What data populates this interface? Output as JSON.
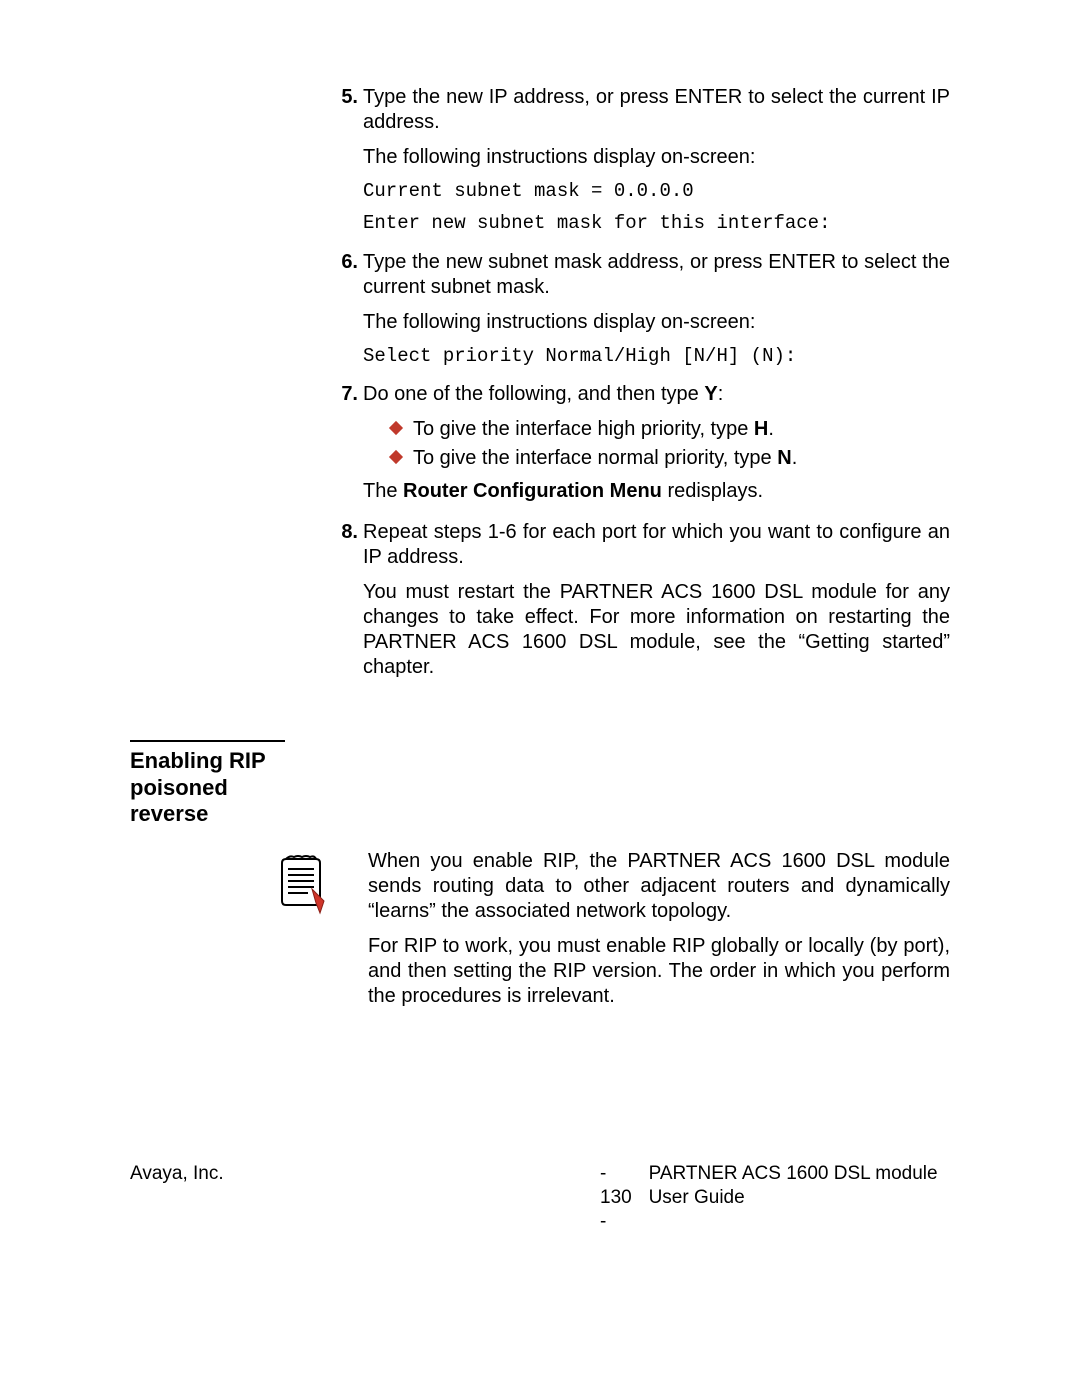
{
  "steps": {
    "s5": {
      "num": "5.",
      "p1": "Type the new IP address, or press ENTER to select the current IP address.",
      "p2": "The following instructions display on-screen:",
      "code1": "Current subnet mask = 0.0.0.0",
      "code2": "Enter new subnet mask for this interface:"
    },
    "s6": {
      "num": "6.",
      "p1": "Type the new subnet mask address, or press ENTER to select the current subnet mask.",
      "p2": "The following instructions display on-screen:",
      "code1": "Select priority Normal/High [N/H] (N):"
    },
    "s7": {
      "num": "7.",
      "p1_pre": "Do one of the following, and then type ",
      "p1_b": "Y",
      "p1_post": ":",
      "b1_pre": "To give the interface high priority, type ",
      "b1_b": "H",
      "b1_post": ".",
      "b2_pre": "To give the interface normal priority, type ",
      "b2_b": "N",
      "b2_post": ".",
      "p2_pre": "The ",
      "p2_b": "Router Configuration Menu",
      "p2_post": " redisplays."
    },
    "s8": {
      "num": "8.",
      "p1": "Repeat steps 1-6 for each port for which you want to configure an IP address.",
      "p2": "You must restart the PARTNER ACS 1600 DSL module for any changes to take effect.  For more information on restarting the PARTNER ACS 1600 DSL module, see the “Getting started” chapter."
    }
  },
  "section_heading": "Enabling RIP poisoned reverse",
  "note": {
    "p1": "When you enable RIP, the PARTNER ACS 1600 DSL module sends routing data to other adjacent routers and dynamically “learns” the associated network topology.",
    "p2": "For RIP to work, you must enable RIP globally or locally (by port), and then setting the RIP version.  The order in which you perform the procedures is irrelevant."
  },
  "footer": {
    "left": "Avaya, Inc.",
    "center": "- 130 -",
    "right": "PARTNER ACS 1600 DSL module User Guide"
  }
}
